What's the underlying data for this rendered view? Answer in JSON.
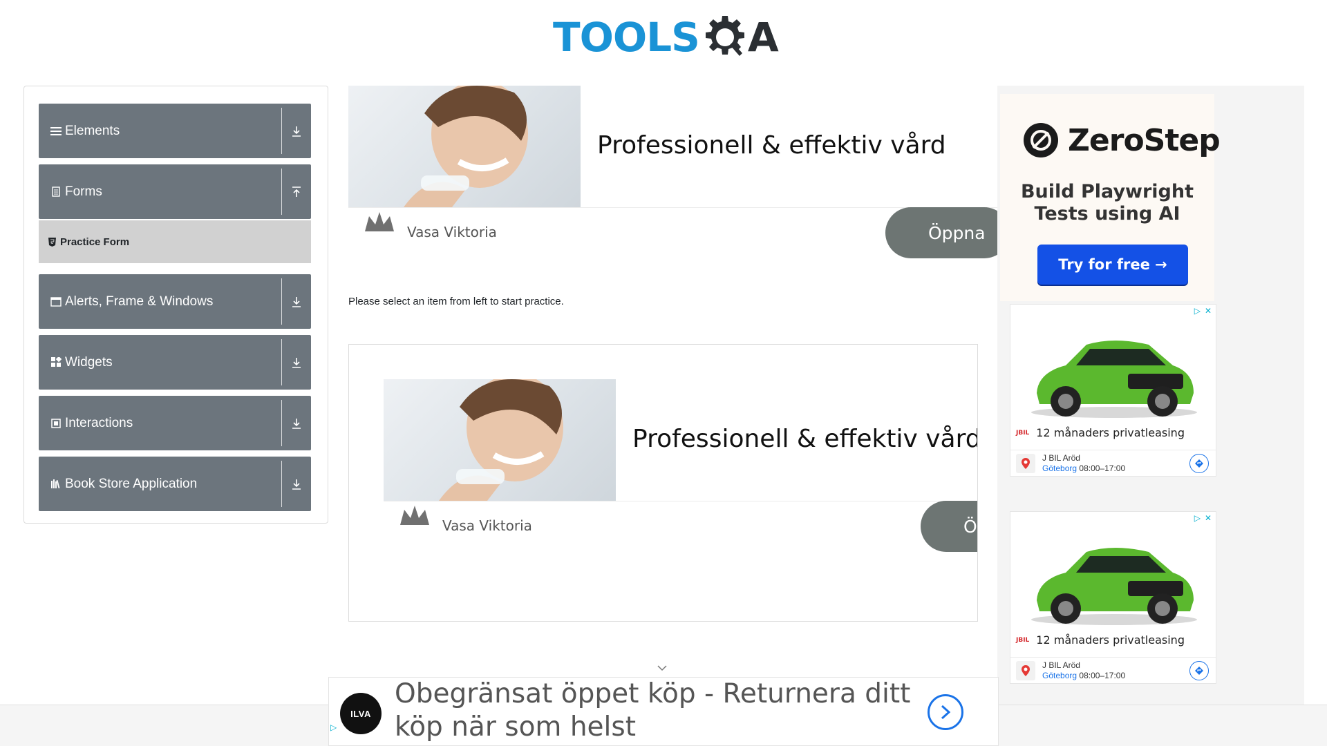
{
  "header": {
    "logo_tools": "TOOLS",
    "logo_qa": "A"
  },
  "sidebar": {
    "groups": [
      {
        "label": "Elements",
        "icon": "menu-icon",
        "arrow": "download-arrow-icon"
      },
      {
        "label": "Forms",
        "icon": "document-icon",
        "arrow": "upload-arrow-icon"
      },
      {
        "label": "Alerts, Frame & Windows",
        "icon": "window-icon",
        "arrow": "download-arrow-icon"
      },
      {
        "label": "Widgets",
        "icon": "widgets-icon",
        "arrow": "download-arrow-icon"
      },
      {
        "label": "Interactions",
        "icon": "interactions-icon",
        "arrow": "download-arrow-icon"
      },
      {
        "label": "Book Store Application",
        "icon": "books-icon",
        "arrow": "download-arrow-icon"
      }
    ],
    "sub_items": [
      {
        "label": "Practice Form",
        "icon": "html5-icon"
      }
    ]
  },
  "main": {
    "ad1": {
      "title": "Professionell & effektiv vård",
      "brand": "Vasa Viktoria",
      "button": "Öppna"
    },
    "info": "Please select an item from left to start practice.",
    "ad2": {
      "title": "Professionell & effektiv vård",
      "brand": "Vasa Viktoria",
      "button": "Öppna"
    }
  },
  "right": {
    "zerostep": {
      "brand": "ZeroStep",
      "tagline_1": "Build Playwright",
      "tagline_2": "Tests using AI",
      "button": "Try for free →"
    },
    "car_ads": [
      {
        "promo": "12 månaders privatleasing",
        "dealer": "J BIL Aröd",
        "city": "Göteborg",
        "hours": "08:00–17:00",
        "logo": "JBIL"
      },
      {
        "promo": "12 månaders privatleasing",
        "dealer": "J BIL Aröd",
        "city": "Göteborg",
        "hours": "08:00–17:00",
        "logo": "JBIL"
      }
    ]
  },
  "bottom_ad": {
    "brand": "ILVA",
    "text": "Obegränsat öppet köp - Returnera ditt köp när som helst"
  },
  "colors": {
    "sidebar_header": "#6c757d",
    "sub_item": "#d1d1d1",
    "accent_blue": "#1a93d6",
    "cta_blue": "#1451e6",
    "ad_button": "#6d7573"
  }
}
